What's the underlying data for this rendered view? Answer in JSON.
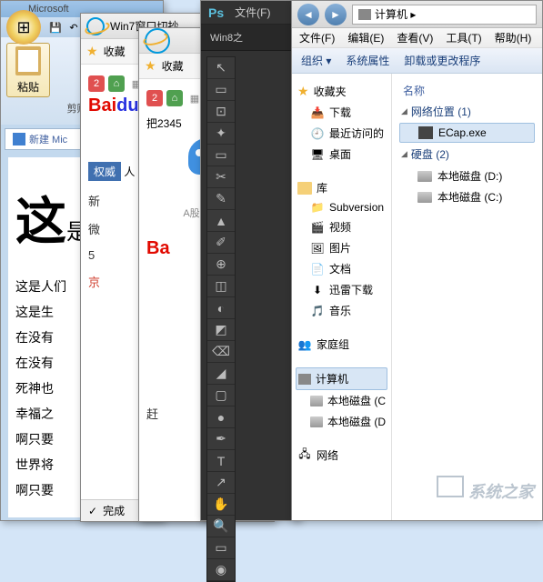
{
  "word": {
    "title_fragment": "Microsoft",
    "paste_label": "粘贴",
    "clipboard_label": "剪贴板",
    "tab_label": "新建 Mic",
    "big_char": "这",
    "big_suffix": "是",
    "lines": [
      "这是人们",
      "这是生",
      "在没有",
      "在没有",
      "死神也",
      "幸福之",
      "啊只要",
      "世界将",
      "啊只要"
    ]
  },
  "ie1": {
    "title": "Win7窗口切抄",
    "fav_label": "收藏",
    "baidu_bai": "Bai",
    "baidu_du": "du",
    "auth_label": "权威",
    "auth_text": "人",
    "items": [
      "新",
      "微",
      "5",
      "京"
    ],
    "status": "完成"
  },
  "ie2": {
    "title": "",
    "fav_label": "收藏",
    "set_home": "把2345",
    "badge": "2",
    "stock_text": "A股上市公",
    "baidu_bai": "Ba",
    "chase": "赶"
  },
  "ps": {
    "logo": "Ps",
    "file_menu": "文件(F)",
    "tab": "Win8之",
    "tools": [
      "↖",
      "▭",
      "⊡",
      "✦",
      "▭",
      "✂",
      "✎",
      "▲",
      "✐",
      "⊕",
      "◫",
      "◐",
      "◩",
      "⌫",
      "◢",
      "▢",
      "●",
      "✒",
      "T",
      "↗",
      "✋",
      "🔍",
      "▭",
      "◉"
    ]
  },
  "explorer": {
    "breadcrumb": "计算机 ▸",
    "menus": [
      "文件(F)",
      "编辑(E)",
      "查看(V)",
      "工具(T)",
      "帮助(H)"
    ],
    "cmds": [
      "组织 ▾",
      "系统属性",
      "卸载或更改程序"
    ],
    "tree": {
      "favorites": {
        "label": "收藏夹",
        "items": [
          "下载",
          "最近访问的",
          "桌面"
        ]
      },
      "library": {
        "label": "库",
        "items": [
          "Subversion",
          "视频",
          "图片",
          "文档",
          "迅雷下载",
          "音乐"
        ]
      },
      "homegroup": "家庭组",
      "computer": {
        "label": "计算机",
        "items": [
          "本地磁盘 (C",
          "本地磁盘 (D"
        ]
      },
      "network": "网络"
    },
    "list": {
      "header": "名称",
      "group1": {
        "label": "网络位置 (1)",
        "items": [
          "ECap.exe"
        ]
      },
      "group2": {
        "label": "硬盘 (2)",
        "items": [
          "本地磁盘 (D:)",
          "本地磁盘 (C:)"
        ]
      }
    }
  },
  "watermark": "系统之家"
}
